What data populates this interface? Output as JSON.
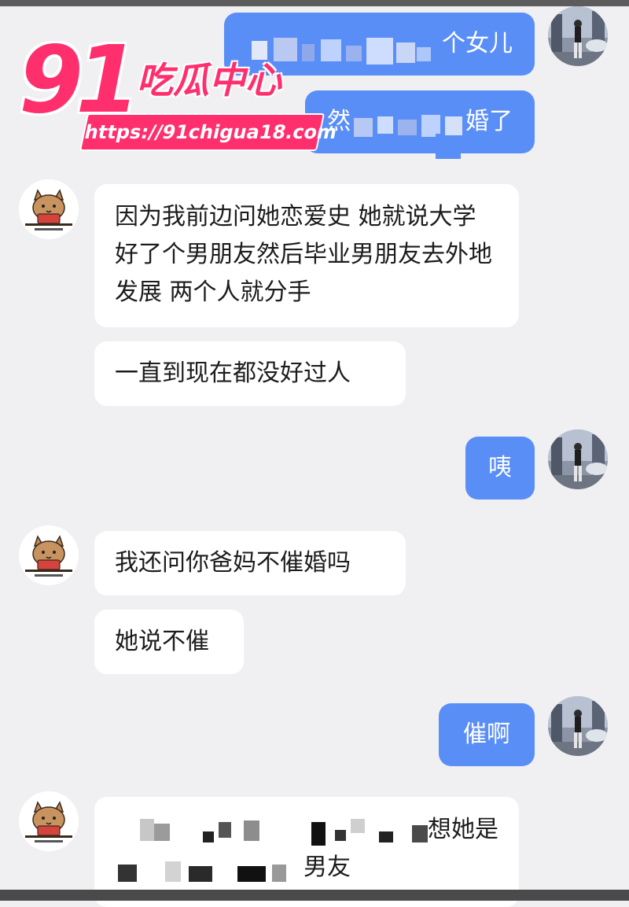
{
  "logo": {
    "number": "91",
    "name": "吃瓜中心",
    "url": "https://91chigua18.com"
  },
  "messages": [
    {
      "side": "out",
      "text": "个女儿"
    },
    {
      "side": "out",
      "text_left": "然",
      "text_right": "婚了"
    },
    {
      "side": "in",
      "text": "因为我前边问她恋爱史 她就说大学好了个男朋友然后毕业男朋友去外地发展 两个人就分手"
    },
    {
      "side": "in",
      "text": "一直到现在都没好过人"
    },
    {
      "side": "out",
      "text": "咦"
    },
    {
      "side": "in",
      "text": "我还问你爸妈不催婚吗"
    },
    {
      "side": "in",
      "text": "她说不催"
    },
    {
      "side": "out",
      "text": "催啊"
    },
    {
      "side": "in",
      "text_line1": "想她是",
      "text_line2": "男友"
    }
  ],
  "colors": {
    "incoming_bubble": "#ffffff",
    "outgoing_bubble": "#5a8ef7",
    "background": "#f0f0f2",
    "logo": "#ff2f6e"
  },
  "icons": {
    "incoming_avatar": "cat-avatar-icon",
    "outgoing_avatar": "person-photo-avatar-icon"
  }
}
